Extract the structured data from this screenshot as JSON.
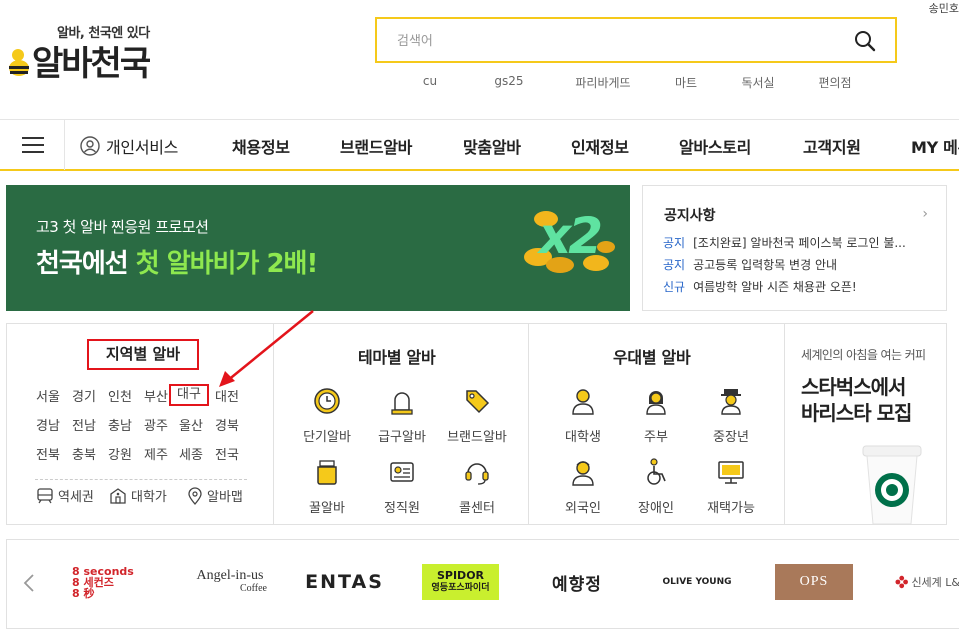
{
  "header": {
    "tagline": "알바, 천국엔 있다",
    "logo_text": "알바천국",
    "user_link": "송민호",
    "search_placeholder": "검색어",
    "keywords": [
      "cu",
      "gs25",
      "파리바게뜨",
      "마트",
      "독서실",
      "편의점"
    ]
  },
  "nav": {
    "items": [
      "개인서비스",
      "채용정보",
      "브랜드알바",
      "맞춤알바",
      "인재정보",
      "알바스토리",
      "고객지원",
      "MY 메뉴"
    ]
  },
  "banner": {
    "sub": "고3 첫 알바 찐응원 프로모션",
    "main_a": "천국에선",
    "main_b": "첫 알바비가 2배!",
    "badge": "x2"
  },
  "notice": {
    "title": "공지사항",
    "more": "›",
    "items": [
      {
        "tag": "공지",
        "text": "[조치완료] 알바천국 페이스북 로그인 불..."
      },
      {
        "tag": "공지",
        "text": "공고등록 입력항목 변경 안내"
      },
      {
        "tag": "신규",
        "text": "여름방학 알바 시즌 채용관 오픈!"
      }
    ]
  },
  "region": {
    "title": "지역별 알바",
    "rows": [
      [
        "서울",
        "경기",
        "인천",
        "부산",
        "대구",
        "대전"
      ],
      [
        "경남",
        "전남",
        "충남",
        "광주",
        "울산",
        "경북"
      ],
      [
        "전북",
        "충북",
        "강원",
        "제주",
        "세종",
        "전국"
      ]
    ],
    "bottom": [
      "역세권",
      "대학가",
      "알바맵"
    ]
  },
  "theme": {
    "title": "테마별 알바",
    "items": [
      "단기알바",
      "급구알바",
      "브랜드알바",
      "꿀알바",
      "정직원",
      "콜센터"
    ]
  },
  "preferred": {
    "title": "우대별 알바",
    "items": [
      "대학생",
      "주부",
      "중장년",
      "외국인",
      "장애인",
      "재택가능"
    ]
  },
  "ad": {
    "small": "세계인의 아침을 여는 커피",
    "line1": "스타벅스에서",
    "line2": "바리스타 모집"
  },
  "brands": {
    "items": [
      "8seconds",
      "Angel-in-us Coffee",
      "ENTAS",
      "SPIDOR 영등포스파이더",
      "예향정",
      "OLIVE YOUNG",
      "OPS",
      "신세계 L&B"
    ],
    "eightsec": [
      "8 seconds",
      "8 세컨즈",
      "8 秒"
    ],
    "angel": [
      "Angel-in-us",
      "Coffee"
    ],
    "entas": "ENTAS",
    "spidor": [
      "SPIDOR",
      "영등포스파이더"
    ],
    "yehyang": "예향정",
    "olive": "OLIVE YOUNG",
    "ops": "OPS",
    "shinsegae": "신세계 L&"
  },
  "colors": {
    "accent": "#f5c91a",
    "banner_bg": "#2a6b43",
    "highlight": "#e3141b",
    "link": "#2866c9"
  }
}
